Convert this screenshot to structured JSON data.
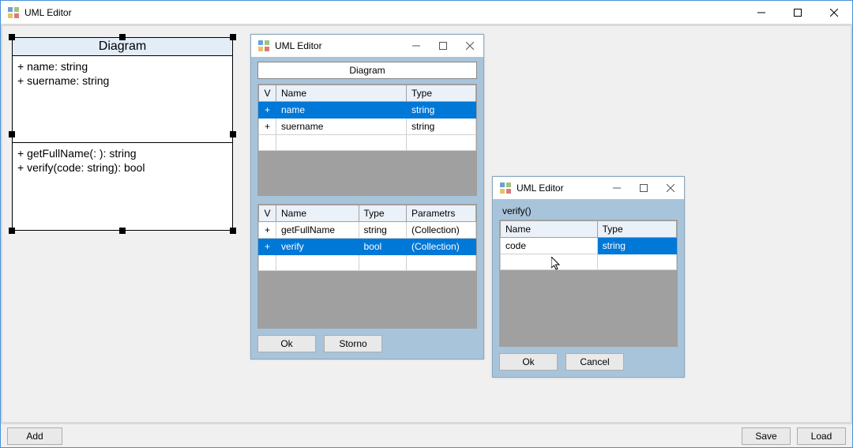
{
  "main": {
    "title": "UML Editor",
    "buttons": {
      "add": "Add",
      "save": "Save",
      "load": "Load"
    }
  },
  "uml": {
    "title": "Diagram",
    "attributes": [
      "+ name: string",
      "+ suername: string"
    ],
    "methods": [
      "+ getFullName(: ): string",
      "+ verify(code: string): bool"
    ]
  },
  "editor1": {
    "title": "UML Editor",
    "diagramName": "Diagram",
    "attrHeaders": {
      "v": "V",
      "name": "Name",
      "type": "Type"
    },
    "attrRows": [
      {
        "v": "+",
        "name": "name",
        "type": "string",
        "selected": true
      },
      {
        "v": "+",
        "name": "suername",
        "type": "string",
        "selected": false
      }
    ],
    "methHeaders": {
      "v": "V",
      "name": "Name",
      "type": "Type",
      "params": "Parametrs"
    },
    "methRows": [
      {
        "v": "+",
        "name": "getFullName",
        "type": "string",
        "params": "(Collection)",
        "selected": false
      },
      {
        "v": "+",
        "name": "verify",
        "type": "bool",
        "params": "(Collection)",
        "selected": true
      }
    ],
    "buttons": {
      "ok": "Ok",
      "storno": "Storno"
    }
  },
  "editor2": {
    "title": "UML Editor",
    "methodLabel": "verify()",
    "paramHeaders": {
      "name": "Name",
      "type": "Type"
    },
    "paramRows": [
      {
        "name": "code",
        "type": "string",
        "selected": "type"
      }
    ],
    "buttons": {
      "ok": "Ok",
      "cancel": "Cancel"
    }
  }
}
